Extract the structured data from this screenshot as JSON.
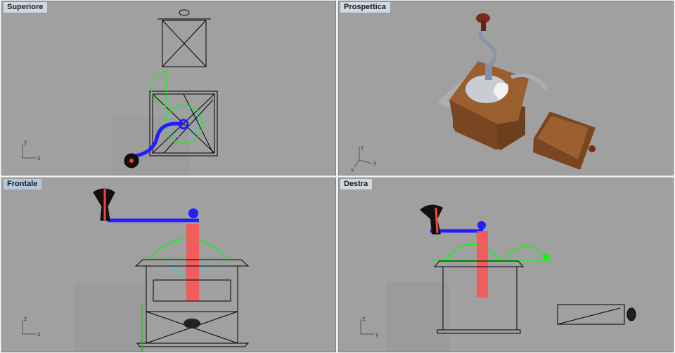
{
  "viewports": {
    "top": {
      "title": "Superiore",
      "axes": [
        "y",
        "x"
      ]
    },
    "perspective": {
      "title": "Prospettica",
      "axes": [
        "z",
        "y",
        "x"
      ]
    },
    "front": {
      "title": "Frontale",
      "axes": [
        "z",
        "x"
      ],
      "active": true
    },
    "right": {
      "title": "Destra",
      "axes": [
        "z",
        "y"
      ]
    }
  },
  "colors": {
    "viewport_bg": "#a0a0a0",
    "wire": "#000000",
    "green": "#00ff00",
    "cyan": "#00e5ff",
    "red": "#ff4040",
    "blue": "#2020ff",
    "wood": "#8a5228"
  }
}
